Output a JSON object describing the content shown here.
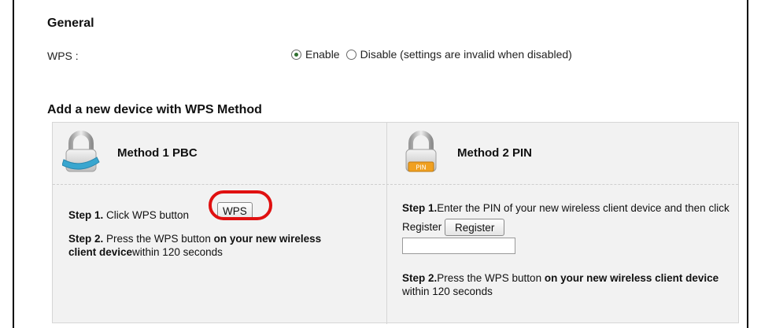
{
  "general": {
    "title": "General",
    "wps_label": "WPS :",
    "enable_label": "Enable",
    "disable_label": "Disable (settings are invalid when disabled)",
    "selected": "Enable"
  },
  "add_device": {
    "title": "Add a new device with WPS Method"
  },
  "method1": {
    "title": "Method 1 PBC",
    "step1_prefix": "Step 1.",
    "step1_text": " Click WPS button",
    "wps_button": "WPS",
    "step2_prefix": "Step 2.",
    "step2_text": " Press the WPS button ",
    "step2_bold": "on your new wireless client device",
    "step2_suffix": "within 120 seconds"
  },
  "method2": {
    "title": "Method 2 PIN",
    "pin_badge": "PIN",
    "step1_prefix": "Step 1.",
    "step1_text": "Enter the PIN of your new wireless client device and then click Register",
    "register_button": "Register",
    "pin_value": "",
    "step2_prefix": "Step 2.",
    "step2_text": "Press the WPS button ",
    "step2_bold": "on your new wireless client device",
    "step2_suffix": " within 120 seconds"
  },
  "colors": {
    "highlight": "#e01010",
    "panel_bg": "#f2f2f2",
    "lock_blue": "#39a6cf",
    "pin_badge": "#f0a020"
  },
  "icons": [
    "lock-pbc-icon",
    "lock-pin-icon"
  ]
}
